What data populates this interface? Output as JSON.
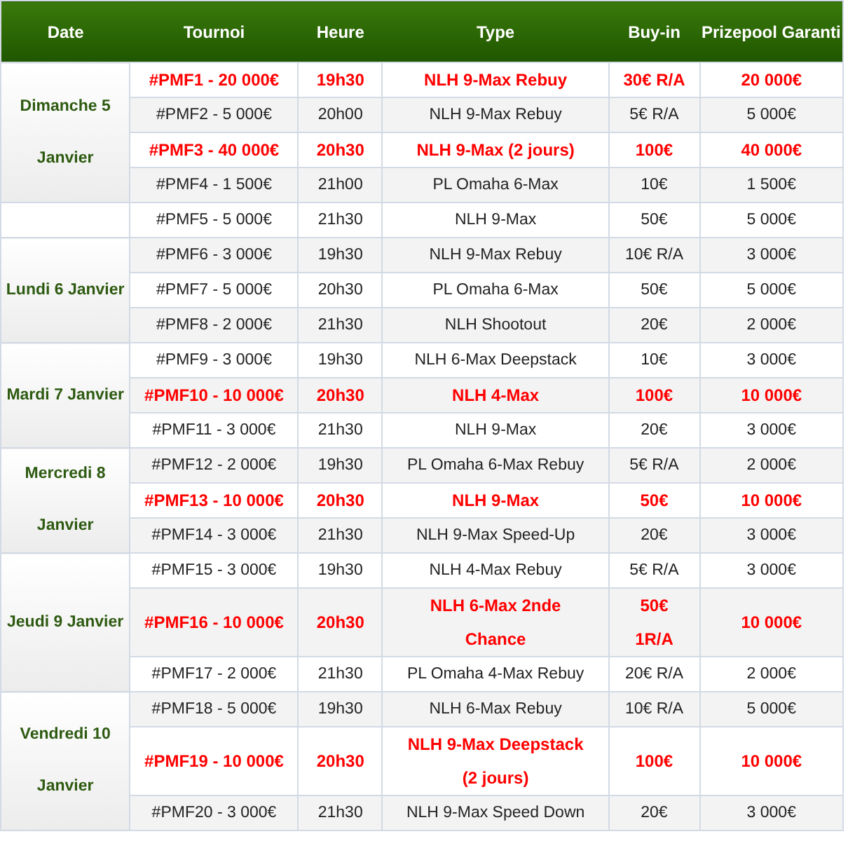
{
  "columns": [
    "Date",
    "Tournoi",
    "Heure",
    "Type",
    "Buy-in",
    "Prizepool Garanti"
  ],
  "groups": [
    {
      "date": "Dimanche 5 Janvier",
      "rows": [
        {
          "tournoi": "#PMF1 - 20 000€",
          "heure": "19h30",
          "type": "NLH 9-Max Rebuy",
          "buyin": "30€ R/A",
          "prizepool": "20 000€",
          "highlight": true
        },
        {
          "tournoi": "#PMF2 - 5 000€",
          "heure": "20h00",
          "type": "NLH 9-Max Rebuy",
          "buyin": "5€ R/A",
          "prizepool": "5 000€",
          "highlight": false
        },
        {
          "tournoi": "#PMF3 - 40 000€",
          "heure": "20h30",
          "type": "NLH 9-Max (2 jours)",
          "buyin": "100€",
          "prizepool": "40 000€",
          "highlight": true
        },
        {
          "tournoi": "#PMF4 - 1 500€",
          "heure": "21h00",
          "type": "PL Omaha 6-Max",
          "buyin": "10€",
          "prizepool": "1 500€",
          "highlight": false
        }
      ]
    },
    {
      "rows": [
        {
          "tournoi": "#PMF5 - 5 000€",
          "heure": "21h30",
          "type": "NLH 9-Max",
          "buyin": "50€",
          "prizepool": "5 000€",
          "highlight": false
        }
      ]
    },
    {
      "date": "Lundi 6 Janvier",
      "rows": [
        {
          "tournoi": "#PMF6 - 3 000€",
          "heure": "19h30",
          "type": "NLH 9-Max Rebuy",
          "buyin": "10€ R/A",
          "prizepool": "3 000€",
          "highlight": false
        },
        {
          "tournoi": "#PMF7 - 5 000€",
          "heure": "20h30",
          "type": "PL Omaha 6-Max",
          "buyin": "50€",
          "prizepool": "5 000€",
          "highlight": false
        },
        {
          "tournoi": "#PMF8 - 2 000€",
          "heure": "21h30",
          "type": "NLH Shootout",
          "buyin": "20€",
          "prizepool": "2 000€",
          "highlight": false
        }
      ]
    },
    {
      "date": "Mardi 7 Janvier",
      "rows": [
        {
          "tournoi": "#PMF9 - 3 000€",
          "heure": "19h30",
          "type": "NLH 6-Max Deepstack",
          "buyin": "10€",
          "prizepool": "3 000€",
          "highlight": false
        },
        {
          "tournoi": "#PMF10 - 10 000€",
          "heure": "20h30",
          "type": "NLH 4-Max",
          "buyin": "100€",
          "prizepool": "10 000€",
          "highlight": true
        },
        {
          "tournoi": "#PMF11 - 3 000€",
          "heure": "21h30",
          "type": "NLH 9-Max",
          "buyin": "20€",
          "prizepool": "3 000€",
          "highlight": false
        }
      ]
    },
    {
      "date": "Mercredi 8 Janvier",
      "rows": [
        {
          "tournoi": "#PMF12 - 2 000€",
          "heure": "19h30",
          "type": "PL Omaha 6-Max Rebuy",
          "buyin": "5€ R/A",
          "prizepool": "2 000€",
          "highlight": false
        },
        {
          "tournoi": "#PMF13 - 10 000€",
          "heure": "20h30",
          "type": "NLH 9-Max",
          "buyin": "50€",
          "prizepool": "10 000€",
          "highlight": true
        },
        {
          "tournoi": "#PMF14 - 3 000€",
          "heure": "21h30",
          "type": "NLH 9-Max Speed-Up",
          "buyin": "20€",
          "prizepool": "3 000€",
          "highlight": false
        }
      ]
    },
    {
      "date": "Jeudi 9 Janvier",
      "rows": [
        {
          "tournoi": "#PMF15 - 3 000€",
          "heure": "19h30",
          "type": "NLH 4-Max Rebuy",
          "buyin": "5€ R/A",
          "prizepool": "3 000€",
          "highlight": false
        },
        {
          "tournoi": "#PMF16 - 10 000€",
          "heure": "20h30",
          "type": "NLH 6-Max 2nde\nChance",
          "buyin": "50€\n1R/A",
          "prizepool": "10 000€",
          "highlight": true
        },
        {
          "tournoi": "#PMF17 - 2 000€",
          "heure": "21h30",
          "type": "PL Omaha 4-Max Rebuy",
          "buyin": "20€ R/A",
          "prizepool": "2 000€",
          "highlight": false
        }
      ]
    },
    {
      "date": "Vendredi 10 Janvier",
      "rows": [
        {
          "tournoi": "#PMF18 - 5 000€",
          "heure": "19h30",
          "type": "NLH 6-Max Rebuy",
          "buyin": "10€ R/A",
          "prizepool": "5 000€",
          "highlight": false
        },
        {
          "tournoi": "#PMF19 - 10 000€",
          "heure": "20h30",
          "type": "NLH 9-Max Deepstack\n(2 jours)",
          "buyin": "100€",
          "prizepool": "10 000€",
          "highlight": true
        },
        {
          "tournoi": "#PMF20 - 3 000€",
          "heure": "21h30",
          "type": "NLH 9-Max Speed Down",
          "buyin": "20€",
          "prizepool": "3 000€",
          "highlight": false
        }
      ]
    }
  ]
}
